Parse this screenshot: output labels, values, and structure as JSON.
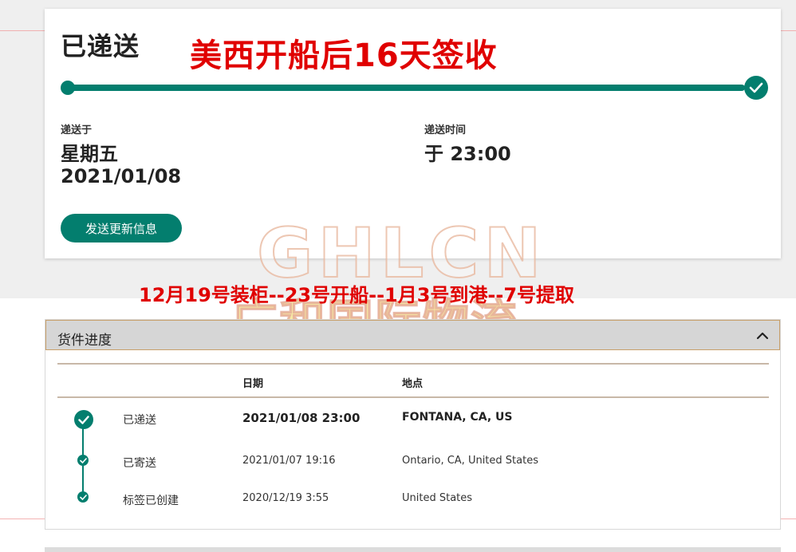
{
  "status_card": {
    "title": "已递送",
    "promo_text": "美西开船后16天签收",
    "progress_percent": 100,
    "delivered_on_label": "递送于",
    "weekday": "星期五",
    "date": "2021/01/08",
    "delivered_time_label": "递送时间",
    "time": "于 23:00",
    "update_button": "发送更新信息"
  },
  "watermark": {
    "latin": "GHLCN",
    "cjk": "广和国际物流"
  },
  "route_note": "12月19号装柜--23号开船--1月3号到港--7号提取",
  "timeline": {
    "title": "货件进度",
    "columns": {
      "date": "日期",
      "location": "地点"
    },
    "rows": [
      {
        "status": "已递送",
        "date": "2021/01/08 23:00",
        "location": "FONTANA, CA, US"
      },
      {
        "status": "已寄送",
        "date": "2021/01/07 19:16",
        "location": "Ontario, CA, United States"
      },
      {
        "status": "标签已创建",
        "date": "2020/12/19 3:55",
        "location": "United States"
      }
    ]
  },
  "colors": {
    "brand_teal": "#037e6e",
    "annotation_red": "#e00000"
  }
}
